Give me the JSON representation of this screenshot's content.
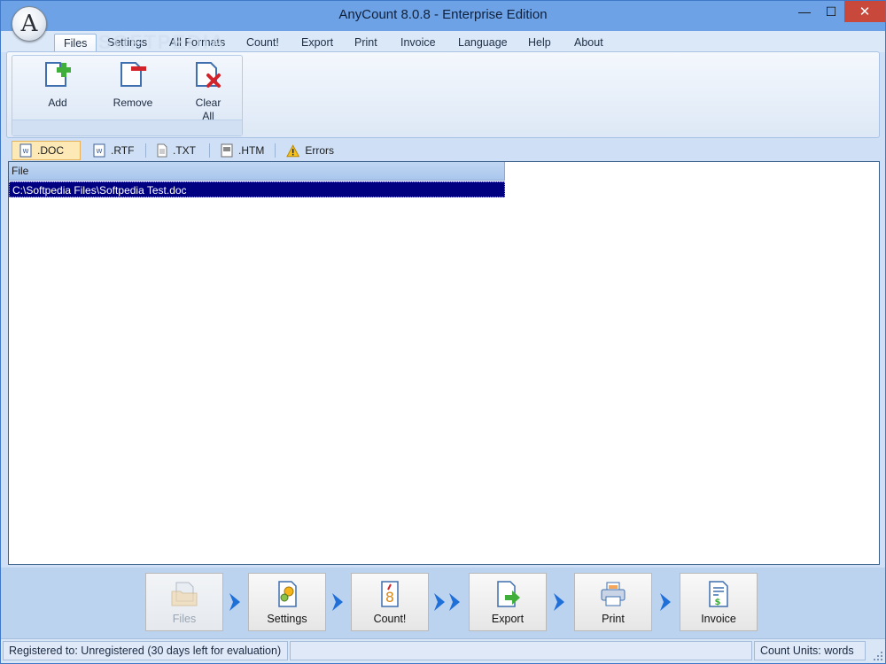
{
  "window": {
    "title": "AnyCount 8.0.8 - Enterprise Edition",
    "logo_letter": "A",
    "minimize_icon": "—",
    "maximize_icon": "☐",
    "close_icon": "✕"
  },
  "watermark": "SOFTPEDIA",
  "menu": {
    "tabs": [
      {
        "label": "Files",
        "active": true
      },
      {
        "label": "Settings"
      },
      {
        "label": "All Formats"
      },
      {
        "label": "Count!"
      },
      {
        "label": "Export"
      },
      {
        "label": "Print"
      },
      {
        "label": "Invoice"
      },
      {
        "label": "Language"
      },
      {
        "label": "Help"
      },
      {
        "label": "About"
      }
    ]
  },
  "ribbon": {
    "buttons": [
      {
        "label": "Add",
        "icon": "add-file-icon"
      },
      {
        "label": "Remove",
        "icon": "remove-file-icon"
      },
      {
        "label_line1": "Clear",
        "label_line2": "All",
        "icon": "clear-all-icon"
      }
    ]
  },
  "format_tabs": [
    {
      "label": ".DOC",
      "icon": "word-doc-icon",
      "active": true
    },
    {
      "label": ".RTF",
      "icon": "rtf-doc-icon"
    },
    {
      "label": ".TXT",
      "icon": "txt-doc-icon"
    },
    {
      "label": ".HTM",
      "icon": "htm-doc-icon"
    },
    {
      "label": "Errors",
      "icon": "warning-icon"
    }
  ],
  "file_list": {
    "column_header": "File",
    "rows": [
      {
        "path": "C:\\Softpedia Files\\Softpedia Test.doc",
        "selected": true
      }
    ]
  },
  "wizard": {
    "steps": [
      {
        "label": "Files",
        "icon": "files-folder-icon",
        "disabled": true
      },
      {
        "label": "Settings",
        "icon": "settings-gear-icon"
      },
      {
        "label": "Count!",
        "icon": "count-icon"
      },
      {
        "label": "Export",
        "icon": "export-icon"
      },
      {
        "label": "Print",
        "icon": "printer-icon"
      },
      {
        "label": "Invoice",
        "icon": "invoice-icon"
      }
    ]
  },
  "status": {
    "registration": "Registered to: Unregistered (30 days left for evaluation)",
    "count_units": "Count Units: words"
  },
  "colors": {
    "titlebar": "#6da3e6",
    "close_button": "#c9483c",
    "selection": "#000080",
    "active_tab": "#fde9b5",
    "add_green": "#3fae3a",
    "remove_red": "#d2232a"
  }
}
